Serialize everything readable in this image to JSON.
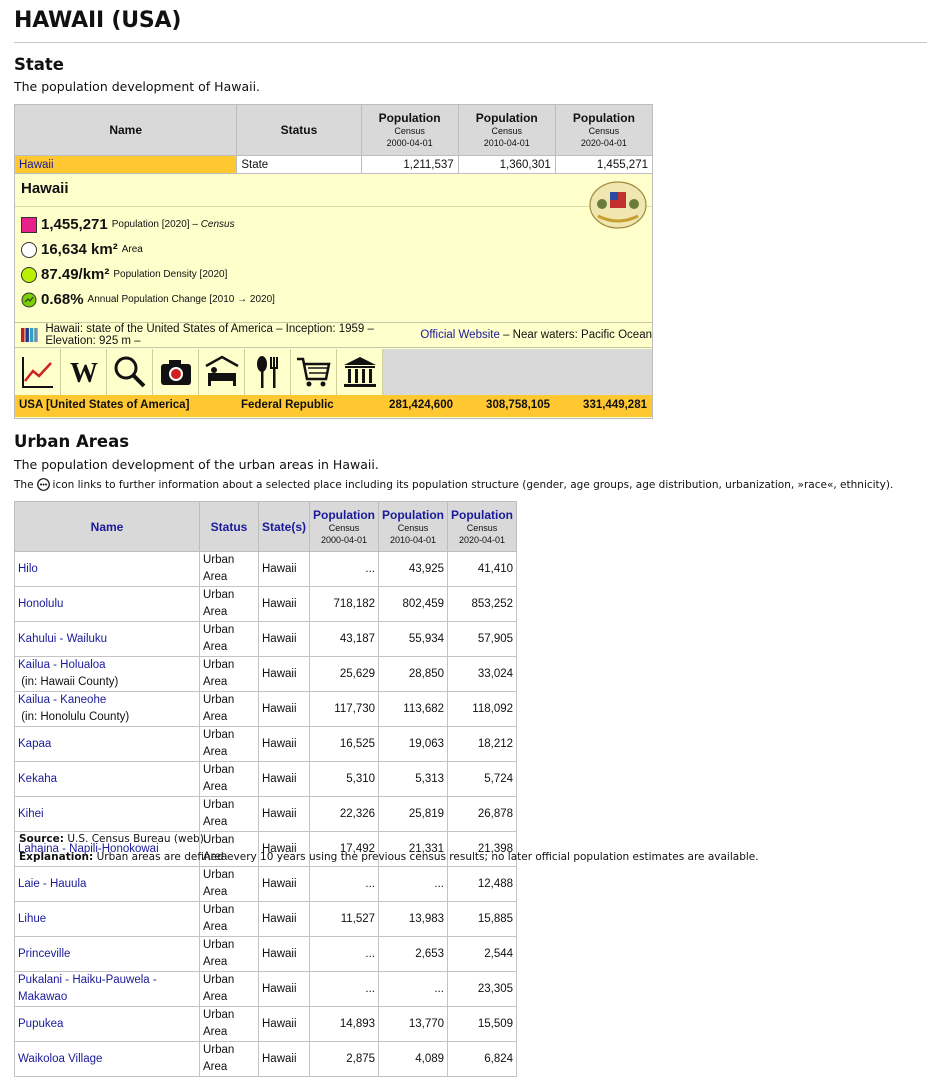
{
  "page_title": "HAWAII (USA)",
  "state_section": {
    "heading": "State",
    "description": "The population development of Hawaii.",
    "headers": {
      "name": "Name",
      "status": "Status",
      "pop_label": "Population",
      "census": "Census",
      "dates": [
        "2000-04-01",
        "2010-04-01",
        "2020-04-01"
      ]
    },
    "row": {
      "name": "Hawaii",
      "status": "State",
      "values": [
        "1,211,537",
        "1,360,301",
        "1,455,271"
      ]
    },
    "panel": {
      "title": "Hawaii",
      "stats": [
        {
          "value": "1,455,271",
          "label": "Population [2020]",
          "note": "Census"
        },
        {
          "value": "16,634 km²",
          "label": "Area"
        },
        {
          "value": "87.49/km²",
          "label": "Population Density [2020]"
        },
        {
          "value": "0.68%",
          "label": "Annual Population Change [2010 → 2020]"
        }
      ],
      "info_prefix": "Hawaii: state of the United States of America – Inception: 1959 – Elevation: 925 m – ",
      "info_link": "Official Website",
      "info_suffix": " – Near waters: Pacific Ocean",
      "colors": {
        "population": "#e8208a",
        "area": "#ffffff",
        "density": "#b8f000",
        "change": "#7ad000"
      },
      "icons": [
        "chart-icon",
        "wikipedia-icon",
        "search-icon",
        "camera-icon",
        "bed-icon",
        "food-icon",
        "cart-icon",
        "museum-icon"
      ]
    },
    "country_row": {
      "name": "USA [United States of America]",
      "status": "Federal Republic",
      "values": [
        "281,424,600",
        "308,758,105",
        "331,449,281"
      ]
    }
  },
  "urban_section": {
    "heading": "Urban Areas",
    "description": "The population development of the urban areas in Hawaii.",
    "note_prefix": "The",
    "note_suffix": "icon links to further information about a selected place including its population structure (gender, age groups, age distribution, urbanization, »race«, ethnicity).",
    "headers": {
      "name": "Name",
      "status": "Status",
      "states": "State(s)",
      "pop_label": "Population",
      "census": "Census",
      "dates": [
        "2000-04-01",
        "2010-04-01",
        "2020-04-01"
      ]
    },
    "rows": [
      {
        "name": "Hilo",
        "extra": "",
        "status": "Urban Area",
        "state": "Hawaii",
        "v": [
          "...",
          "43,925",
          "41,410"
        ]
      },
      {
        "name": "Honolulu",
        "extra": "",
        "status": "Urban Area",
        "state": "Hawaii",
        "v": [
          "718,182",
          "802,459",
          "853,252"
        ]
      },
      {
        "name": "Kahului - Wailuku",
        "extra": "",
        "status": "Urban Area",
        "state": "Hawaii",
        "v": [
          "43,187",
          "55,934",
          "57,905"
        ]
      },
      {
        "name": "Kailua - Holualoa",
        "extra": " (in: Hawaii County)",
        "status": "Urban Area",
        "state": "Hawaii",
        "v": [
          "25,629",
          "28,850",
          "33,024"
        ]
      },
      {
        "name": "Kailua - Kaneohe",
        "extra": " (in: Honolulu County)",
        "status": "Urban Area",
        "state": "Hawaii",
        "v": [
          "117,730",
          "113,682",
          "118,092"
        ]
      },
      {
        "name": "Kapaa",
        "extra": "",
        "status": "Urban Area",
        "state": "Hawaii",
        "v": [
          "16,525",
          "19,063",
          "18,212"
        ]
      },
      {
        "name": "Kekaha",
        "extra": "",
        "status": "Urban Area",
        "state": "Hawaii",
        "v": [
          "5,310",
          "5,313",
          "5,724"
        ]
      },
      {
        "name": "Kihei",
        "extra": "",
        "status": "Urban Area",
        "state": "Hawaii",
        "v": [
          "22,326",
          "25,819",
          "26,878"
        ]
      },
      {
        "name": "Lahaina - Napili-Honokowai",
        "extra": "",
        "status": "Urban Area",
        "state": "Hawaii",
        "v": [
          "17,492",
          "21,331",
          "21,398"
        ]
      },
      {
        "name": "Laie - Hauula",
        "extra": "",
        "status": "Urban Area",
        "state": "Hawaii",
        "v": [
          "...",
          "...",
          "12,488"
        ]
      },
      {
        "name": "Lihue",
        "extra": "",
        "status": "Urban Area",
        "state": "Hawaii",
        "v": [
          "11,527",
          "13,983",
          "15,885"
        ]
      },
      {
        "name": "Princeville",
        "extra": "",
        "status": "Urban Area",
        "state": "Hawaii",
        "v": [
          "...",
          "2,653",
          "2,544"
        ]
      },
      {
        "name": "Pukalani - Haiku-Pauwela - Makawao",
        "extra": "",
        "status": "Urban Area",
        "state": "Hawaii",
        "v": [
          "...",
          "...",
          "23,305"
        ]
      },
      {
        "name": "Pupukea",
        "extra": "",
        "status": "Urban Area",
        "state": "Hawaii",
        "v": [
          "14,893",
          "13,770",
          "15,509"
        ]
      },
      {
        "name": "Waikoloa Village",
        "extra": "",
        "status": "Urban Area",
        "state": "Hawaii",
        "v": [
          "2,875",
          "4,089",
          "6,824"
        ]
      }
    ]
  },
  "source": {
    "label": "Source:",
    "text": "U.S. Census Bureau (web)."
  },
  "explanation": {
    "label": "Explanation:",
    "text": "Urban areas are defined every 10 years using the previous census results; no later official population estimates are available."
  }
}
